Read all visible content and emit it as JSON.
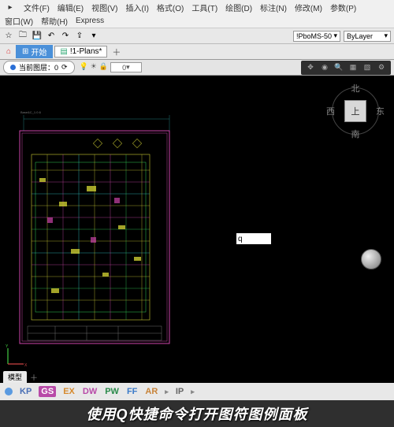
{
  "menu": {
    "row1": [
      "文件(F)",
      "编辑(E)",
      "视图(V)",
      "插入(I)",
      "格式(O)",
      "工具(T)",
      "绘图(D)",
      "标注(N)",
      "修改(M)",
      "参数(P)"
    ],
    "row2": [
      "窗口(W)",
      "帮助(H)",
      "Express"
    ]
  },
  "toolbar": {
    "combo1": "!PboMS-50",
    "combo2": "ByLayer"
  },
  "tabs": {
    "start": "开始",
    "file": "!1-Plans*"
  },
  "layer": {
    "label": "当前图层：0",
    "value": "0"
  },
  "viewcube": {
    "top": "上",
    "north": "北",
    "south": "南",
    "east": "东",
    "west": "西"
  },
  "command": {
    "text": "q"
  },
  "modeltab": "模型",
  "status": {
    "items": [
      "KP",
      "GS",
      "EX",
      "DW",
      "PW",
      "FF",
      "AR",
      "IP"
    ]
  },
  "caption": "使用Q快捷命令打开图符图例面板"
}
